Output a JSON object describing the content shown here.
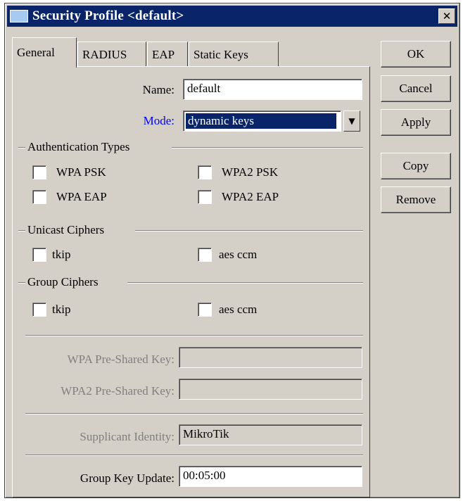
{
  "window": {
    "title": "Security Profile <default>",
    "close_glyph": "✕",
    "colors": {
      "titlebar": "#0a246a",
      "face": "#d4d0c8",
      "mode_label": "#0000ff"
    }
  },
  "tabs": [
    {
      "label": "General",
      "active": true
    },
    {
      "label": "RADIUS",
      "active": false
    },
    {
      "label": "EAP",
      "active": false
    },
    {
      "label": "Static Keys",
      "active": false
    }
  ],
  "buttons": {
    "ok": "OK",
    "cancel": "Cancel",
    "apply": "Apply",
    "copy": "Copy",
    "remove": "Remove"
  },
  "general": {
    "name_label": "Name:",
    "name_value": "default",
    "mode_label": "Mode:",
    "mode_value": "dynamic keys",
    "auth_types": {
      "heading": "Authentication Types",
      "wpa_psk": "WPA PSK",
      "wpa2_psk": "WPA2 PSK",
      "wpa_eap": "WPA EAP",
      "wpa2_eap": "WPA2 EAP"
    },
    "unicast": {
      "heading": "Unicast Ciphers",
      "tkip": "tkip",
      "aes": "aes ccm"
    },
    "group": {
      "heading": "Group Ciphers",
      "tkip": "tkip",
      "aes": "aes ccm"
    },
    "wpa_psk_label": "WPA Pre-Shared Key:",
    "wpa_psk_value": "",
    "wpa2_psk_label": "WPA2 Pre-Shared Key:",
    "wpa2_psk_value": "",
    "supplicant_label": "Supplicant Identity:",
    "supplicant_value": "MikroTik",
    "gku_label": "Group Key Update:",
    "gku_value": "00:05:00"
  }
}
